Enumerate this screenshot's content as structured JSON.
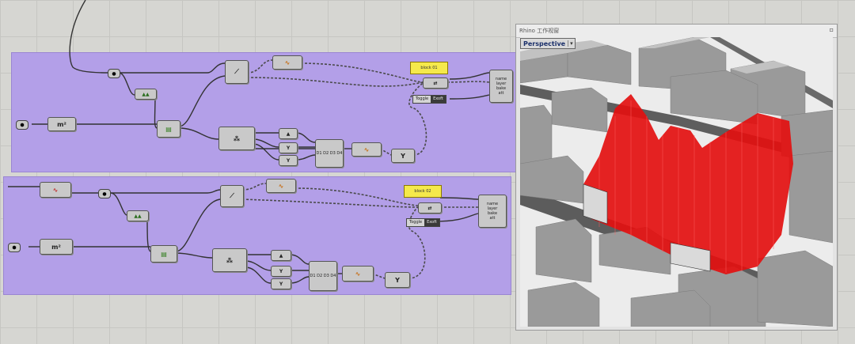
{
  "viewport": {
    "title": "Rhino 工作视窗",
    "active_view": "Perspective",
    "dropdown_glyph": "▾",
    "close_glyph": "▫"
  },
  "group_top": {
    "panel_text": "block 01",
    "toggle_label": "Toggle",
    "toggle_value": "Exoft",
    "bake_inputs": [
      "name",
      "layer",
      "bake",
      "att"
    ]
  },
  "group_bottom": {
    "panel_text": "block 02",
    "toggle_label": "Toggle",
    "toggle_value": "Exoft",
    "bake_inputs": [
      "name",
      "layer",
      "bake",
      "att"
    ]
  },
  "icons": {
    "surface": "m²",
    "area": "▲▲",
    "extrude": "▤",
    "split": "⁂",
    "graph": "∿",
    "tree": "Y"
  },
  "colors": {
    "canvas": "#d6d6d2",
    "group_fill": "#b39fe8",
    "panel_yellow": "#f5e94b",
    "mesh_red": "#e31010"
  }
}
